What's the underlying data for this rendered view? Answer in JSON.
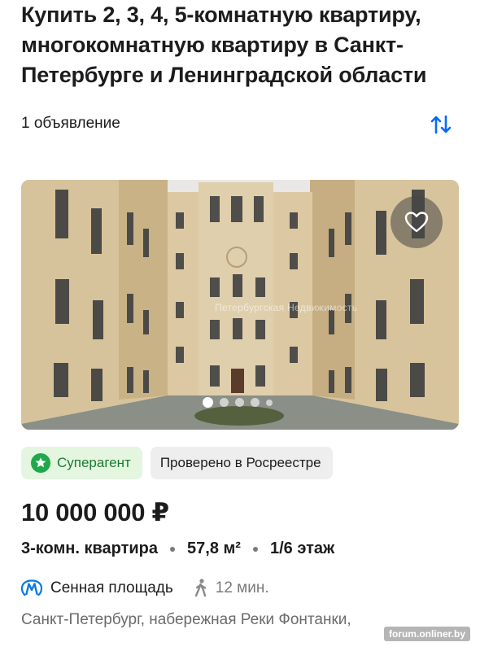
{
  "header": {
    "title": "Купить 2, 3, 4, 5-комнатную квартиру, многокомнатную квартиру в Санкт-Петербурге и Ленинградской области"
  },
  "results": {
    "count_text": "1 объявление",
    "sort_icon": "sort-arrows-icon"
  },
  "listing": {
    "photo": {
      "description_icon": "favorite-heart-icon",
      "watermark": "Петербургская Недвижимость",
      "slides_total": 5,
      "active_slide": 1
    },
    "badges": [
      {
        "label": "Суперагент",
        "icon": "star-badge-icon"
      },
      {
        "label": "Проверено в Росреестре"
      }
    ],
    "price": "10 000 000 ₽",
    "params": [
      "3-комн. квартира",
      "57,8 м²",
      "1/6 этаж"
    ],
    "metro": {
      "icon": "metro-icon",
      "station": "Сенная площадь",
      "walk_icon": "walking-person-icon",
      "walk_time": "12 мин."
    },
    "address": "Санкт-Петербург, набережная Реки Фонтанки,"
  },
  "colors": {
    "accent": "#0468ff",
    "super_badge_bg": "#e4f5e0",
    "super_badge_text": "#1b7a34",
    "metro_icon": "#0a7ae0"
  },
  "site_watermark": "forum.onliner.by"
}
